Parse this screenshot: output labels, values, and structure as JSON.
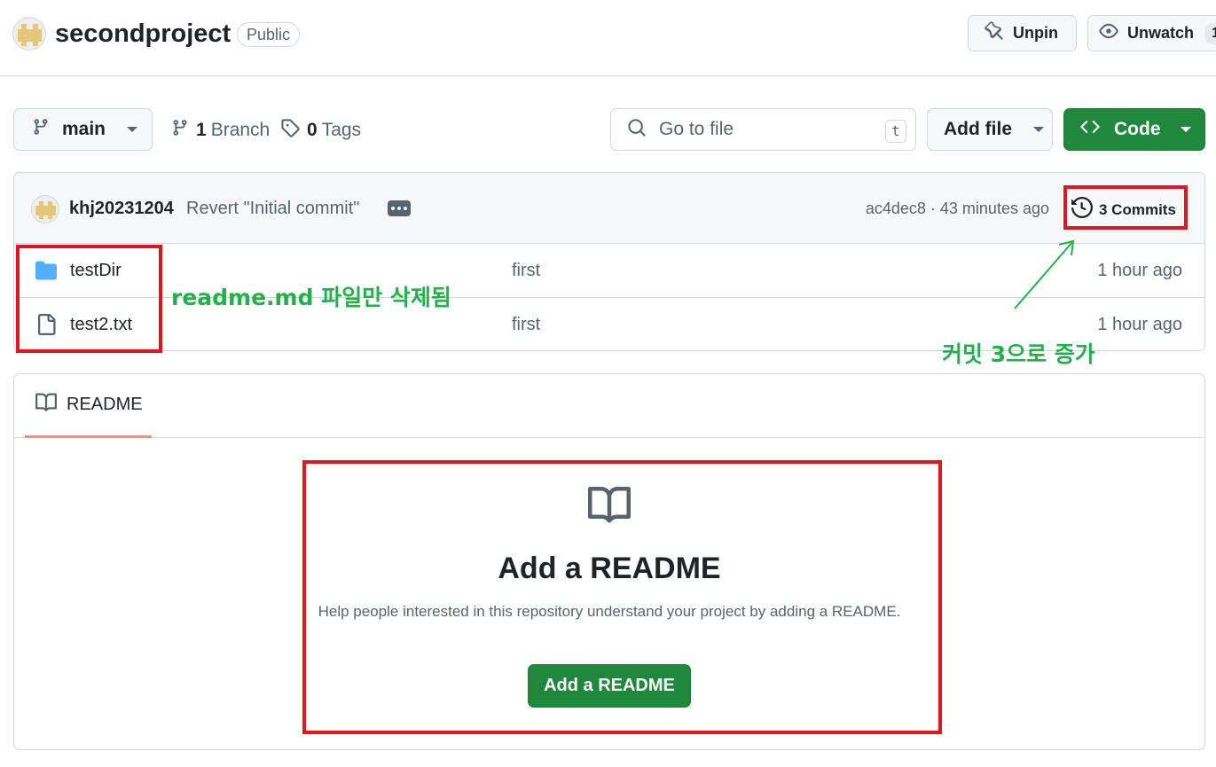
{
  "header": {
    "repo_name": "secondproject",
    "visibility": "Public",
    "unpin_label": "Unpin",
    "unwatch_label": "Unwatch",
    "watch_count": "1"
  },
  "toolbar": {
    "branch_name": "main",
    "branches_count": "1",
    "branches_label": "Branch",
    "tags_count": "0",
    "tags_label": "Tags",
    "search_placeholder": "Go to file",
    "search_shortcut": "t",
    "add_file_label": "Add file",
    "code_label": "Code"
  },
  "latest_commit": {
    "author": "khj20231204",
    "message": "Revert \"Initial commit\"",
    "hash": "ac4dec8",
    "time": "43 minutes ago",
    "commits_label": "3 Commits"
  },
  "files": [
    {
      "name": "testDir",
      "type": "folder",
      "commit_message": "first",
      "age": "1 hour ago"
    },
    {
      "name": "test2.txt",
      "type": "file",
      "commit_message": "first",
      "age": "1 hour ago"
    }
  ],
  "readme": {
    "tab_label": "README",
    "title": "Add a README",
    "description": "Help people interested in this repository understand your project by adding a README.",
    "button_label": "Add a README"
  },
  "annotations": {
    "files_note": "readme.md 파일만 삭제됨",
    "commits_note": "커밋 3으로 증가",
    "box_color": "#e3141e",
    "text_color": "#22b04b"
  },
  "colors": {
    "primary_green": "#1f883d",
    "border": "#d0d7de",
    "muted_text": "#59636e",
    "folder_blue": "#54aeff",
    "tab_underline": "#fd8c73"
  }
}
